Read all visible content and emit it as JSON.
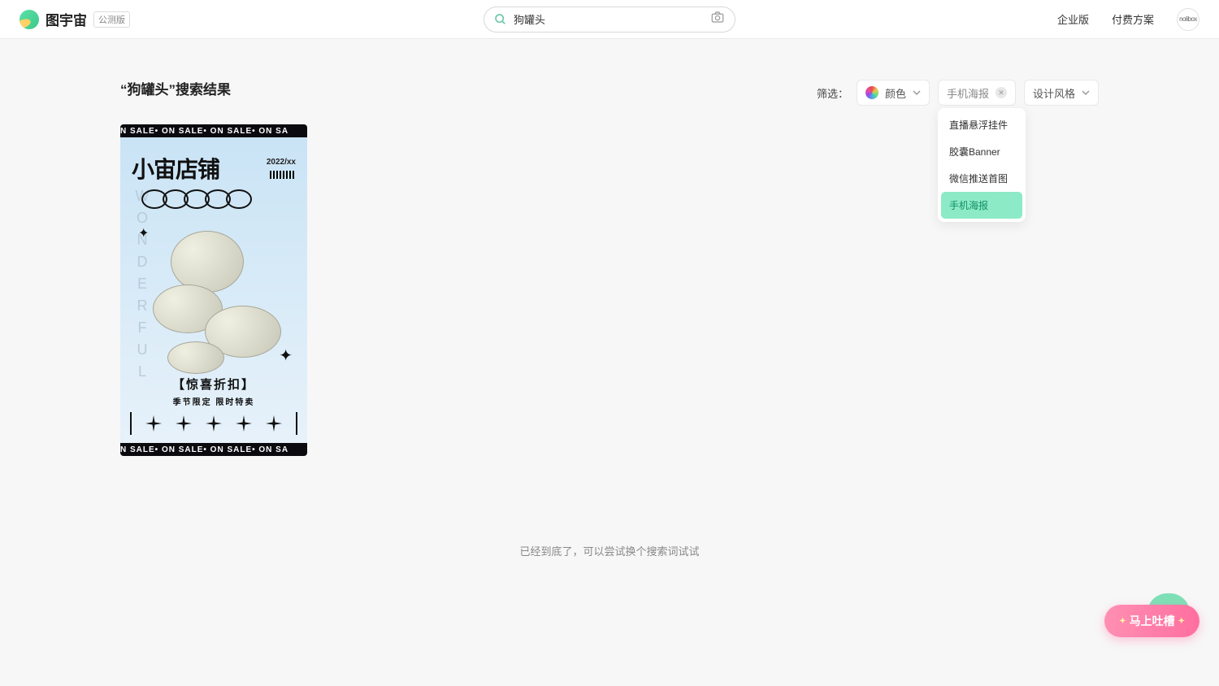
{
  "header": {
    "logo_text": "图宇宙",
    "beta_badge": "公测版",
    "search_value": "狗罐头",
    "nav_enterprise": "企业版",
    "nav_pricing": "付费方案",
    "avatar_text": "nolibox"
  },
  "search_results": {
    "title": "“狗罐头”搜索结果"
  },
  "filters": {
    "label": "筛选：",
    "color_label": "颜色",
    "type_selected": "手机海报",
    "style_label": "设计风格",
    "type_options": [
      "直播悬浮挂件",
      "胶囊Banner",
      "微信推送首图",
      "手机海报"
    ]
  },
  "card": {
    "sale_strip": "N  SALE• ON  SALE• ON  SALE• ON  SA",
    "title": "小宙店铺",
    "year": "2022/xx",
    "vertical_text": "WONDERFUL",
    "promo_bracket": "【惊喜折扣】",
    "promo_sub": "季节限定  限时特卖"
  },
  "end_message": "已经到底了，可以尝试换个搜索词试试",
  "feedback_label": "马上吐槽"
}
